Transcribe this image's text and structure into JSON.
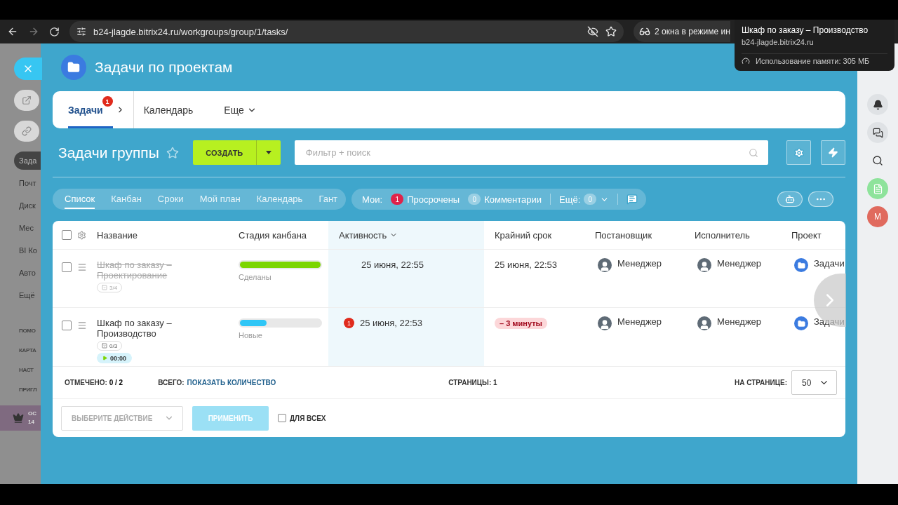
{
  "browser": {
    "url": "b24-jlagde.bitrix24.ru/workgroups/group/1/tasks/",
    "incognito": "2 окна в режиме ин"
  },
  "tab_tooltip": {
    "title": "Шкаф по заказу – Производство",
    "host": "b24-jlagde.bitrix24.ru",
    "memory": "Использование памяти: 305 МБ"
  },
  "left_menu": {
    "items": [
      {
        "label": "Зада",
        "selected": true
      },
      {
        "label": "Почт",
        "selected": false
      },
      {
        "label": "Диск",
        "selected": false
      },
      {
        "label": "Мес",
        "selected": false
      },
      {
        "label": "BI Ко",
        "selected": false
      },
      {
        "label": "Авто",
        "selected": false
      },
      {
        "label": "Ещё",
        "selected": false
      }
    ],
    "sections": [
      "ПОМО",
      "КАРТА",
      "НАСТ",
      "ПРИГЛ"
    ],
    "plan": {
      "line1": "ОС",
      "line2": "14"
    }
  },
  "right_bar": {
    "avatar": "М"
  },
  "panel": {
    "title": "Задачи по проектам"
  },
  "tabs": [
    {
      "label": "Задачи",
      "selected": true,
      "badge": "1"
    },
    {
      "label": "Календарь",
      "selected": false
    },
    {
      "label": "Еще",
      "selected": false
    }
  ],
  "toolbar": {
    "title": "Задачи группы",
    "create": "СОЗДАТЬ",
    "filter_placeholder": "Фильтр + поиск"
  },
  "views": [
    {
      "label": "Список",
      "selected": true
    },
    {
      "label": "Канбан",
      "selected": false
    },
    {
      "label": "Сроки",
      "selected": false
    },
    {
      "label": "Мой план",
      "selected": false
    },
    {
      "label": "Календарь",
      "selected": false
    },
    {
      "label": "Гант",
      "selected": false
    }
  ],
  "counters": {
    "label": "Мои:",
    "items": [
      {
        "count": "1",
        "label": "Просрочены",
        "kind": "alert"
      },
      {
        "count": "0",
        "label": "Комментарии",
        "kind": "neutral"
      }
    ],
    "more_label": "Ещё:",
    "more_count": "0"
  },
  "table": {
    "all_checked": false,
    "columns": [
      {
        "label": "Название",
        "sorted": false
      },
      {
        "label": "Стадия канбана",
        "sorted": false
      },
      {
        "label": "Активность",
        "sorted": true
      },
      {
        "label": "Крайний срок",
        "sorted": false
      },
      {
        "label": "Постановщик",
        "sorted": false
      },
      {
        "label": "Исполнитель",
        "sorted": false
      },
      {
        "label": "Проект",
        "sorted": false
      }
    ],
    "rows": [
      {
        "checked": false,
        "title": "Шкаф по заказу – Проектирование",
        "completed": true,
        "checklist": "3/4",
        "stage": {
          "label": "Сделаны",
          "level": 1,
          "color": "#7bd500"
        },
        "activity": "25 июня, 22:55",
        "deadline": {
          "text": "25 июня, 22:53",
          "overdue": false
        },
        "creator": "Менеджер",
        "responsible": "Менеджер",
        "project": "Задачи"
      },
      {
        "checked": false,
        "title": "Шкаф по заказу – Производство",
        "completed": false,
        "checklist": "0/3",
        "timer": "00:00",
        "stage": {
          "label": "Новые",
          "level": 0.33,
          "color": "#2fc6f6"
        },
        "activity_count": "1",
        "activity": "25 июня, 22:53",
        "deadline": {
          "text": "– 3 минуты",
          "overdue": true
        },
        "creator": "Менеджер",
        "responsible": "Менеджер",
        "project": "Задачи"
      }
    ]
  },
  "footer": {
    "checked_label": "ОТМЕЧЕНО:",
    "checked_value": "0 / 2",
    "total_label": "ВСЕГО:",
    "total_link": "ПОКАЗАТЬ КОЛИЧЕСТВО",
    "pages_label": "СТРАНИЦЫ:",
    "pages_value": "1",
    "per_page_label": "НА СТРАНИЦЕ:",
    "per_page": "50"
  },
  "actions": {
    "select": "ВЫБЕРИТЕ ДЕЙСТВИЕ",
    "apply": "ПРИМЕНИТЬ",
    "apply_disabled": true,
    "for_all": "ДЛЯ ВСЕХ",
    "for_all_checked": false
  }
}
